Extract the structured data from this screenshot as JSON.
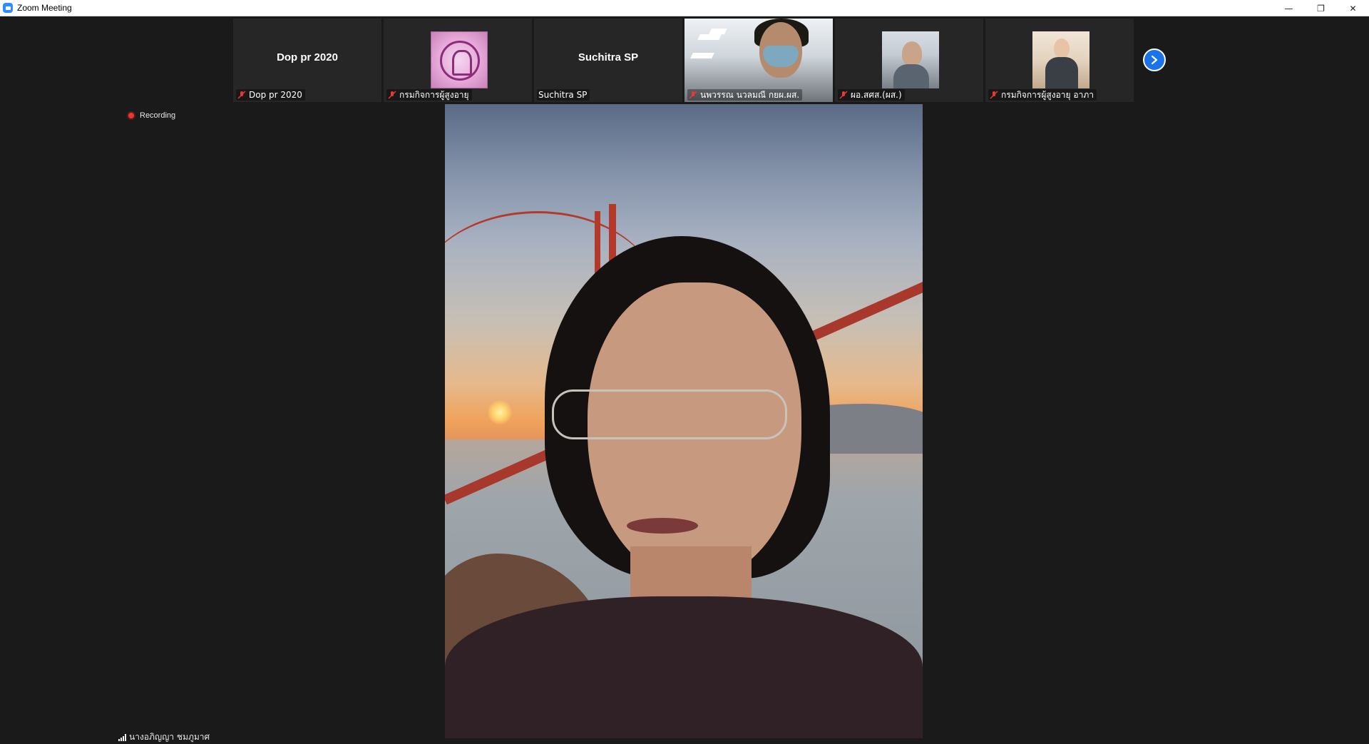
{
  "window": {
    "title": "Zoom Meeting",
    "controls": {
      "minimize": "—",
      "restore": "❐",
      "close": "✕"
    }
  },
  "thumbnails": [
    {
      "display_name": "Dop pr 2020",
      "label": "Dop pr 2020",
      "muted": true
    },
    {
      "display_name": "",
      "label": "กรมกิจการผู้สูงอายุ",
      "muted": true
    },
    {
      "display_name": "Suchitra SP",
      "label": "Suchitra SP",
      "muted": false
    },
    {
      "display_name": "",
      "label": "นพวรรณ นวลมณี กยผ.ผส.",
      "muted": true
    },
    {
      "display_name": "",
      "label": "ผอ.สศส.(ผส.)",
      "muted": true
    },
    {
      "display_name": "",
      "label": "กรมกิจการผู้สูงอายุ อาภา",
      "muted": true
    }
  ],
  "recording": {
    "label": "Recording"
  },
  "active_speaker": {
    "name": "นางอภิญญา ชมภูมาศ"
  },
  "colors": {
    "accent": "#1a73e8",
    "record": "#e53935",
    "mute": "#e53935"
  }
}
